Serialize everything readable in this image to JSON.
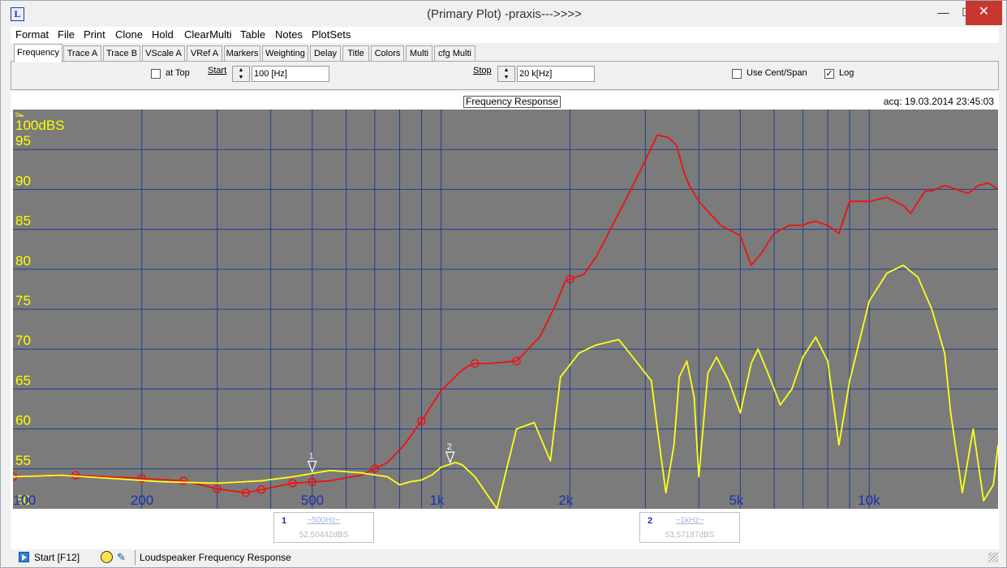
{
  "window": {
    "title": "(Primary Plot) -praxis--->>>>",
    "app_icon": "L"
  },
  "window_controls": {
    "minimize": "—",
    "maximize": "☐",
    "close": "✕"
  },
  "menu": [
    "Format",
    "File",
    "Print",
    "Clone",
    "Hold",
    "ClearMulti",
    "Table",
    "Notes",
    "PlotSets"
  ],
  "tabs": [
    "Frequency",
    "Trace A",
    "Trace B",
    "VScale A",
    "VRef A",
    "Markers",
    "Weighting",
    "Delay",
    "Title",
    "Colors",
    "Multi",
    "cfg Multi"
  ],
  "active_tab": "Frequency",
  "toolbar": {
    "at_top_label": "at Top",
    "at_top_checked": false,
    "start_label": "Start",
    "start_value": "100 [Hz]",
    "stop_label": "Stop",
    "stop_value": "20 k[Hz]",
    "use_cent_span_label": "Use Cent/Span",
    "use_cent_span_checked": false,
    "log_label": "Log",
    "log_checked": true,
    "check_mark": "✓"
  },
  "plot": {
    "title": "Frequency Response",
    "acq": "acq: 19.03.2014 23:45:03"
  },
  "markers": [
    {
      "num": "1",
      "freq": "~500Hz~",
      "value": "52,50442dBS"
    },
    {
      "num": "2",
      "freq": "~1kHz~",
      "value": "53,57187dBS"
    }
  ],
  "status": {
    "start_label": "Start [F12]",
    "text": "Loudspeaker Frequency Response"
  },
  "chart_data": {
    "type": "line",
    "title": "Frequency Response",
    "x_scale": "log",
    "xlim": [
      100,
      20000
    ],
    "ylim": [
      50,
      100
    ],
    "ylabel_top": "100dBS",
    "y_ticks": [
      "95",
      "90",
      "85",
      "80",
      "75",
      "70",
      "65",
      "60",
      "55",
      "50"
    ],
    "x_ticks": [
      {
        "v": 100,
        "label": "100"
      },
      {
        "v": 200,
        "label": "200"
      },
      {
        "v": 500,
        "label": "500"
      },
      {
        "v": 1000,
        "label": "1k"
      },
      {
        "v": 2000,
        "label": "2k"
      },
      {
        "v": 5000,
        "label": "5k"
      },
      {
        "v": 10000,
        "label": "10k"
      }
    ],
    "grid": true,
    "colors": {
      "background": "#7b7b7b",
      "grid": "#1f3f8f",
      "axis_text": "#ffff00",
      "trace_a": "#ee1111",
      "trace_b": "#ffff1a"
    },
    "series": [
      {
        "color": "#ee1111",
        "x": [
          100,
          140,
          200,
          250,
          300,
          350,
          380,
          450,
          550,
          650,
          750,
          820,
          900,
          1000,
          1100,
          1150,
          1200,
          1300,
          1500,
          1700,
          1850,
          1950,
          2050,
          2150,
          2300,
          2600,
          2900,
          3200,
          3400,
          3550,
          3700,
          3800,
          4000,
          4500,
          5000,
          5300,
          5600,
          6000,
          6500,
          7000,
          7200,
          7500,
          8000,
          8500,
          9000,
          10000,
          11000,
          12000,
          12500,
          13500,
          14000,
          15000,
          16000,
          17000,
          18000,
          19000,
          20000
        ],
        "y": [
          54,
          54.2,
          53.8,
          53.5,
          52.5,
          52,
          52.4,
          53.2,
          53.5,
          54.2,
          55.8,
          58,
          61,
          64.8,
          67,
          67.8,
          68.2,
          68.2,
          68.5,
          71.5,
          75.5,
          78.5,
          79,
          79.3,
          81.5,
          87,
          92,
          96.8,
          96.5,
          95.5,
          92,
          90.5,
          88.5,
          85.5,
          84.2,
          80.5,
          82,
          84.5,
          85.5,
          85.5,
          85.8,
          86,
          85.5,
          84.5,
          88.5,
          88.5,
          89,
          88,
          87,
          89.8,
          89.8,
          90.5,
          90,
          89.5,
          90.5,
          90.8,
          90
        ],
        "markers_x": [
          100,
          140,
          200,
          250,
          300,
          350,
          380,
          450,
          500,
          700,
          900,
          1200,
          1500,
          2000
        ]
      },
      {
        "color": "#ffff1a",
        "x": [
          100,
          130,
          170,
          220,
          300,
          380,
          450,
          550,
          650,
          750,
          800,
          850,
          900,
          950,
          1000,
          1080,
          1120,
          1200,
          1350,
          1500,
          1650,
          1800,
          1900,
          2100,
          2300,
          2600,
          2900,
          3100,
          3200,
          3350,
          3500,
          3600,
          3750,
          3900,
          4000,
          4200,
          4400,
          4700,
          5000,
          5300,
          5500,
          5800,
          6200,
          6600,
          7000,
          7500,
          8000,
          8500,
          9000,
          10000,
          11000,
          12000,
          13000,
          14000,
          15000,
          15500,
          16500,
          17500,
          18500,
          19500,
          20000
        ],
        "y": [
          54,
          54.2,
          53.8,
          53.4,
          53.2,
          53.5,
          54,
          54.8,
          54.5,
          54,
          53,
          53.4,
          53.6,
          54.2,
          55.2,
          55.8,
          55.5,
          54,
          50,
          60,
          60.8,
          56,
          66.5,
          69.5,
          70.5,
          71.2,
          68,
          66,
          60,
          52,
          58,
          66.5,
          68.5,
          64,
          54,
          67,
          69,
          66,
          62,
          68.2,
          70,
          67,
          63,
          65,
          69,
          71.5,
          68.5,
          58,
          66,
          76,
          79.5,
          80.5,
          79,
          75,
          69.5,
          62,
          52,
          60,
          51,
          53,
          58
        ]
      }
    ],
    "point_labels": [
      {
        "x": 500,
        "label": "1"
      },
      {
        "x": 1050,
        "label": "2"
      }
    ]
  }
}
